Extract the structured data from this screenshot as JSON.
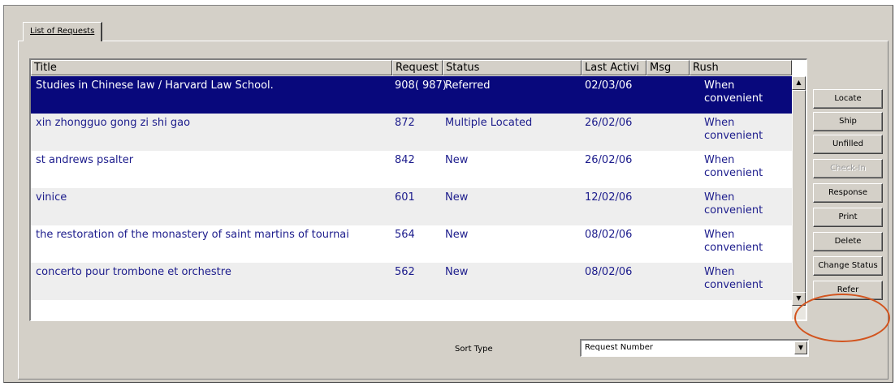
{
  "tab": {
    "label": "List of Requests"
  },
  "table": {
    "columns": [
      "Title",
      "Request No",
      "Status",
      "Last Activi",
      "Msg",
      "Rush"
    ],
    "rows": [
      {
        "title": "Studies in Chinese law / Harvard Law School.",
        "request_no": "908( 987)",
        "status": "Referred",
        "last_activity": "02/03/06",
        "msg": "",
        "rush_1": "When",
        "rush_2": "convenient"
      },
      {
        "title": "xin zhongguo gong zi shi gao",
        "request_no": "872",
        "status": "Multiple Located",
        "last_activity": "26/02/06",
        "msg": "",
        "rush_1": "When",
        "rush_2": "convenient"
      },
      {
        "title": "st andrews psalter",
        "request_no": "842",
        "status": "New",
        "last_activity": "26/02/06",
        "msg": "",
        "rush_1": "When",
        "rush_2": "convenient"
      },
      {
        "title": "vinice",
        "request_no": "601",
        "status": "New",
        "last_activity": "12/02/06",
        "msg": "",
        "rush_1": "When",
        "rush_2": "convenient"
      },
      {
        "title": "the restoration of the monastery of saint martins of tournai",
        "request_no": "564",
        "status": "New",
        "last_activity": "08/02/06",
        "msg": "",
        "rush_1": "When",
        "rush_2": "convenient"
      },
      {
        "title": "concerto pour trombone et orchestre",
        "request_no": "562",
        "status": "New",
        "last_activity": "08/02/06",
        "msg": "",
        "rush_1": "When",
        "rush_2": "convenient"
      }
    ]
  },
  "buttons": [
    {
      "label": "Locate",
      "enabled": true
    },
    {
      "label": "Ship",
      "enabled": true
    },
    {
      "label": "Unfilled",
      "enabled": true
    },
    {
      "label": "Check-In",
      "enabled": false
    },
    {
      "label": "Response",
      "enabled": true
    },
    {
      "label": "Print",
      "enabled": true
    },
    {
      "label": "Delete",
      "enabled": true
    },
    {
      "label": "Change Status",
      "enabled": true
    },
    {
      "label": "Refer",
      "enabled": true
    }
  ],
  "sort": {
    "label": "Sort Type",
    "value": "Request Number"
  },
  "colors": {
    "selection": "#08087c",
    "row_text": "#1c1c8c",
    "annotation": "#d2541e"
  },
  "icons": {
    "scroll_up": "scroll-up-arrow-icon",
    "scroll_down": "scroll-down-arrow-icon",
    "dropdown": "dropdown-arrow-icon"
  }
}
